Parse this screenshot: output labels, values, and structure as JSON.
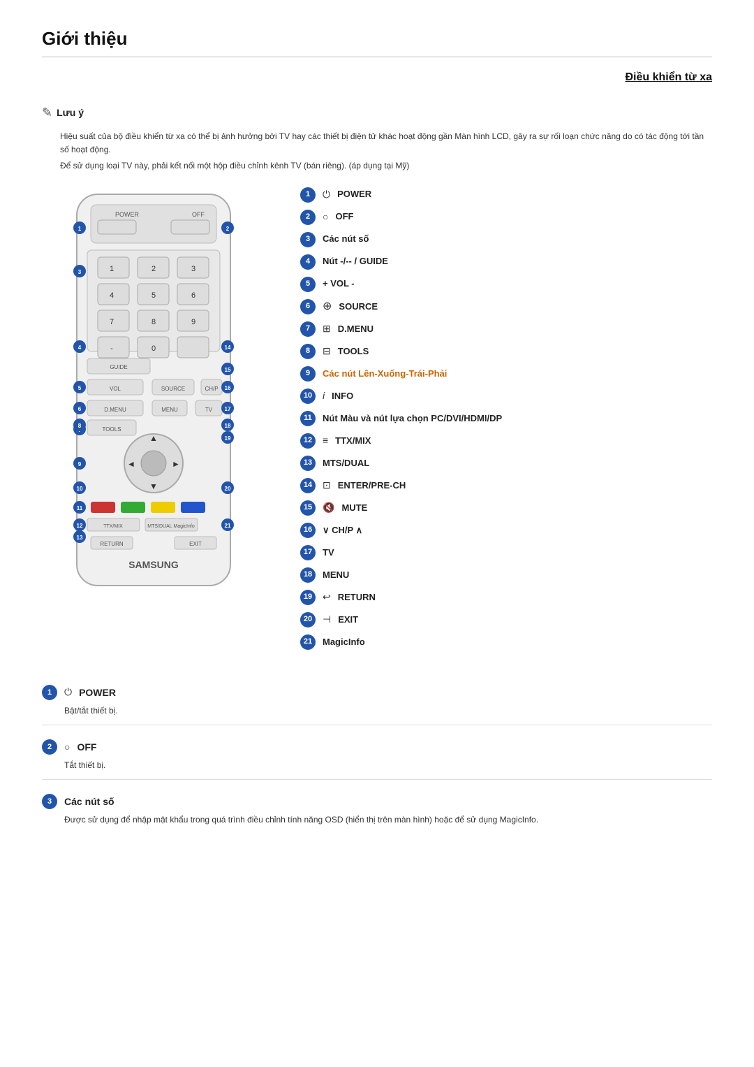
{
  "page": {
    "title": "Giới thiệu",
    "section_heading": "Điều khiển từ xa",
    "note_label": "Lưu ý",
    "note_text_1": "Hiệu suất của bộ điều khiển từ xa có thể bị ảnh hưởng bởi TV hay các thiết bị điện tử khác hoạt động gần Màn hình LCD, gây ra sự rối loạn chức năng do có tác động tới tần số hoạt động.",
    "note_text_2": "Để sử dụng loại TV này, phải kết nối một hộp điều chỉnh kênh TV (bán riêng). (áp dụng tại Mỹ)"
  },
  "labels": [
    {
      "num": "1",
      "icon": "⏻",
      "text": "POWER"
    },
    {
      "num": "2",
      "icon": "○",
      "text": "OFF"
    },
    {
      "num": "3",
      "icon": "",
      "text": "Các nút số"
    },
    {
      "num": "4",
      "icon": "",
      "text": "Nút -/-- / GUIDE"
    },
    {
      "num": "5",
      "icon": "",
      "text": "+ VOL -"
    },
    {
      "num": "6",
      "icon": "⊕",
      "text": "SOURCE"
    },
    {
      "num": "7",
      "icon": "⊞",
      "text": "D.MENU"
    },
    {
      "num": "8",
      "icon": "⊟",
      "text": "TOOLS"
    },
    {
      "num": "9",
      "icon": "",
      "text": "Các nút Lên-Xuống-Trái-Phải",
      "highlight": true
    },
    {
      "num": "10",
      "icon": "𝑖",
      "text": "INFO"
    },
    {
      "num": "11",
      "icon": "",
      "text": "Nút Màu và nút lựa chọn PC/DVI/HDMI/DP"
    },
    {
      "num": "12",
      "icon": "≡",
      "text": "TTX/MIX"
    },
    {
      "num": "13",
      "icon": "",
      "text": "MTS/DUAL"
    },
    {
      "num": "14",
      "icon": "⊡",
      "text": "ENTER/PRE-CH"
    },
    {
      "num": "15",
      "icon": "🔇",
      "text": "MUTE"
    },
    {
      "num": "16",
      "icon": "",
      "text": "∨ CH/P ∧"
    },
    {
      "num": "17",
      "icon": "",
      "text": "TV"
    },
    {
      "num": "18",
      "icon": "",
      "text": "MENU"
    },
    {
      "num": "19",
      "icon": "↩",
      "text": "RETURN"
    },
    {
      "num": "20",
      "icon": "⊣",
      "text": "EXIT"
    },
    {
      "num": "21",
      "icon": "",
      "text": "MagicInfo"
    }
  ],
  "bottom_items": [
    {
      "num": "1",
      "icon": "⏻",
      "title": "POWER",
      "desc": "Bật/tắt thiết bị."
    },
    {
      "num": "2",
      "icon": "○",
      "title": "OFF",
      "desc": "Tắt thiết bị."
    },
    {
      "num": "3",
      "icon": "",
      "title": "Các nút số",
      "desc": "Được sử dụng để nhập mật khẩu trong quá trình điều chỉnh tính năng OSD (hiển thị trên màn hình) hoặc để sử dụng MagicInfo."
    }
  ]
}
